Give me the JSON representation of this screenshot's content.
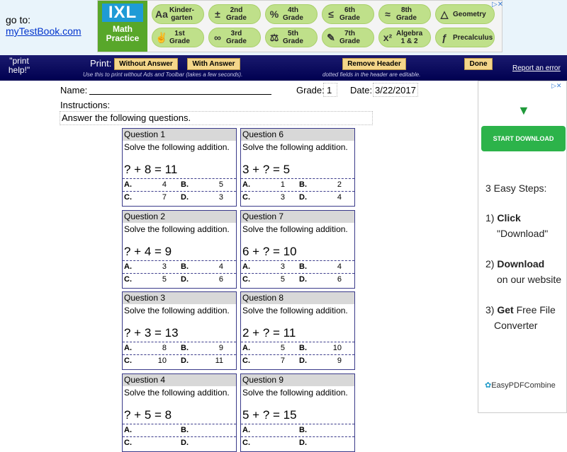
{
  "goto": {
    "label": "go to:",
    "link": "myTestBook.com"
  },
  "ixl": {
    "logo_top": "IXL",
    "logo_bottom": "Math Practice",
    "items": [
      {
        "label": "Kinder-\ngarten",
        "icon": "Aa"
      },
      {
        "label": "2nd\nGrade",
        "icon": "±"
      },
      {
        "label": "4th\nGrade",
        "icon": "%"
      },
      {
        "label": "6th\nGrade",
        "icon": "≤"
      },
      {
        "label": "8th\nGrade",
        "icon": "≈"
      },
      {
        "label": "Geometry",
        "icon": "△"
      },
      {
        "label": "1st\nGrade",
        "icon": "✌"
      },
      {
        "label": "3rd\nGrade",
        "icon": "∞"
      },
      {
        "label": "5th\nGrade",
        "icon": "⚖"
      },
      {
        "label": "7th\nGrade",
        "icon": "✎"
      },
      {
        "label": "Algebra\n1 & 2",
        "icon": "x²"
      },
      {
        "label": "Precalculus",
        "icon": "ƒ"
      }
    ],
    "ad_choice": "▷✕"
  },
  "toolbar": {
    "print_help": "\"print help!\"",
    "print_label": "Print:",
    "without_answer": "Without Answer",
    "with_answer": "With Answer",
    "remove_header": "Remove Header",
    "done": "Done",
    "note_left": "Use this to print without Ads and Toolbar (takes a few seconds).",
    "note_right": "dotted fields in the header are editable.",
    "report": "Report an error"
  },
  "worksheet": {
    "name_label": "Name:",
    "grade_label": "Grade:",
    "grade_value": "1",
    "date_label": "Date:",
    "date_value": "3/22/2017",
    "instructions_label": "Instructions:",
    "instructions_text": "Answer the following questions."
  },
  "questions": [
    {
      "title": "Question 1",
      "instr": "Solve the following addition.",
      "eq": "? + 8 = 11",
      "A": "4",
      "B": "5",
      "C": "7",
      "D": "3"
    },
    {
      "title": "Question 6",
      "instr": "Solve the following addition.",
      "eq": "3 + ? = 5",
      "A": "1",
      "B": "2",
      "C": "3",
      "D": "4"
    },
    {
      "title": "Question 2",
      "instr": "Solve the following addition.",
      "eq": "? + 4 = 9",
      "A": "3",
      "B": "4",
      "C": "5",
      "D": "6"
    },
    {
      "title": "Question 7",
      "instr": "Solve the following addition.",
      "eq": "6 + ? = 10",
      "A": "3",
      "B": "4",
      "C": "5",
      "D": "6"
    },
    {
      "title": "Question 3",
      "instr": "Solve the following addition.",
      "eq": "? + 3 = 13",
      "A": "8",
      "B": "9",
      "C": "10",
      "D": "11"
    },
    {
      "title": "Question 8",
      "instr": "Solve the following addition.",
      "eq": "2 + ? = 11",
      "A": "5",
      "B": "10",
      "C": "7",
      "D": "9"
    },
    {
      "title": "Question 4",
      "instr": "Solve the following addition.",
      "eq": "? + 5 = 8",
      "A": "",
      "B": "",
      "C": "",
      "D": ""
    },
    {
      "title": "Question 9",
      "instr": "Solve the following addition.",
      "eq": "5 + ? = 15",
      "A": "",
      "B": "",
      "C": "",
      "D": ""
    }
  ],
  "option_labels": {
    "A": "A.",
    "B": "B.",
    "C": "C.",
    "D": "D."
  },
  "ad": {
    "arrow": "▼",
    "button": "START DOWNLOAD",
    "steps_title": "3 Easy Steps:",
    "step1_num": "1)",
    "step1_bold": "Click",
    "step1_rest": "\"Download\"",
    "step2_num": "2)",
    "step2_bold": "Download",
    "step2_rest": "on our website",
    "step3_num": "3)",
    "step3_bold": "Get",
    "step3_mid": "Free File",
    "step3_rest": "Converter",
    "brand": "EasyPDFCombine",
    "ad_choice": "▷✕"
  },
  "colors": {
    "toolbar": "#000050",
    "button": "#f4d68a",
    "download": "#2cb34a",
    "ixl_green": "#bfe08a"
  }
}
